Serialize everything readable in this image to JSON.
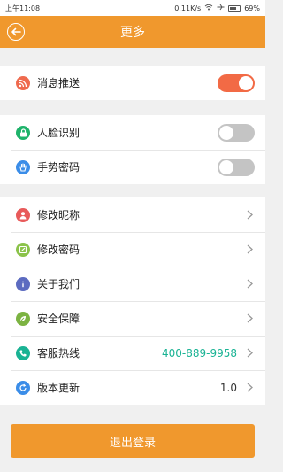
{
  "statusbar": {
    "time": "上午11:08",
    "speed": "0.11K/s",
    "battery": "69%"
  },
  "header": {
    "title": "更多"
  },
  "sections": {
    "push": {
      "label": "消息推送",
      "toggle_on": true,
      "icon": "rss-icon",
      "icon_color": "#ef6a4e"
    },
    "face": {
      "label": "人脸识别",
      "toggle_on": false,
      "icon": "lock-icon",
      "icon_color": "#1fb36b"
    },
    "gesture": {
      "label": "手势密码",
      "toggle_on": false,
      "icon": "hand-icon",
      "icon_color": "#3b8de8"
    },
    "nickname": {
      "label": "修改昵称",
      "icon": "person-icon",
      "icon_color": "#e85a5a"
    },
    "password": {
      "label": "修改密码",
      "icon": "edit-icon",
      "icon_color": "#8bc34a"
    },
    "about": {
      "label": "关于我们",
      "icon": "info-icon",
      "icon_color": "#5c6bc0"
    },
    "security": {
      "label": "安全保障",
      "icon": "leaf-icon",
      "icon_color": "#7cb342"
    },
    "hotline": {
      "label": "客服热线",
      "value": "400-889-9958",
      "value_color": "#1ab394",
      "icon": "phone-icon",
      "icon_color": "#1ab394"
    },
    "version": {
      "label": "版本更新",
      "value": "1.0",
      "icon": "refresh-icon",
      "icon_color": "#3b8de8"
    }
  },
  "logout": {
    "label": "退出登录"
  },
  "colors": {
    "accent": "#f0982d",
    "toggle_on": "#f26a45",
    "toggle_off": "#c4c4c4"
  }
}
